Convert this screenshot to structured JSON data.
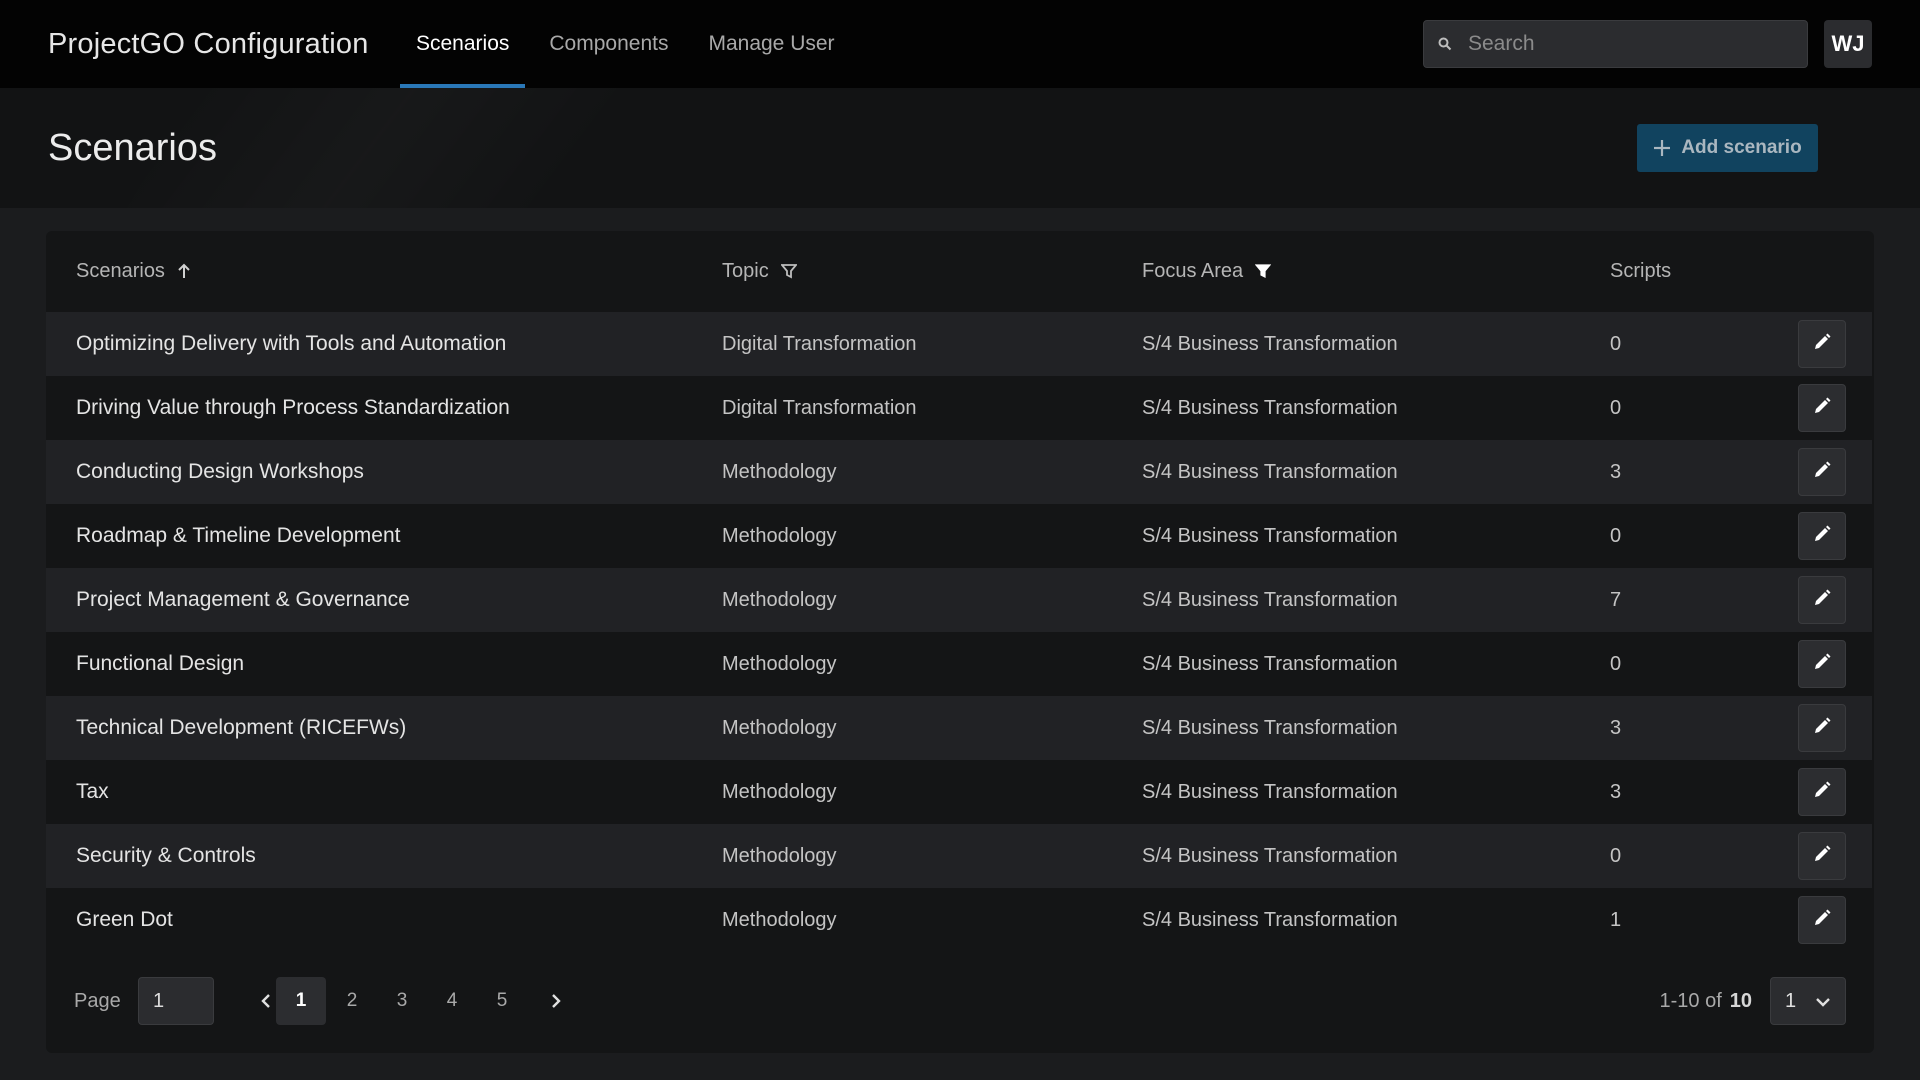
{
  "header": {
    "app_title": "ProjectGO Configuration",
    "tabs": [
      {
        "label": "Scenarios",
        "active": true
      },
      {
        "label": "Components",
        "active": false
      },
      {
        "label": "Manage User",
        "active": false
      }
    ],
    "search_placeholder": "Search",
    "search_icon": "search-icon",
    "avatar_initials": "WJ"
  },
  "subheader": {
    "title": "Scenarios",
    "add_button_label": "Add scenario",
    "add_icon": "plus-icon"
  },
  "table": {
    "columns": {
      "scenarios": "Scenarios",
      "topic": "Topic",
      "focus_area": "Focus Area",
      "scripts": "Scripts"
    },
    "sort_icon": "arrow-up-icon",
    "filter_icon": "filter-icon",
    "edit_icon": "pencil-icon",
    "rows": [
      {
        "name": "Optimizing Delivery with Tools and Automation",
        "topic": "Digital Transformation",
        "focus_area": "S/4 Business Transformation",
        "scripts": "0"
      },
      {
        "name": "Driving Value through Process Standardization",
        "topic": "Digital Transformation",
        "focus_area": "S/4 Business Transformation",
        "scripts": "0"
      },
      {
        "name": "Conducting Design Workshops",
        "topic": "Methodology",
        "focus_area": "S/4 Business Transformation",
        "scripts": "3"
      },
      {
        "name": "Roadmap & Timeline Development",
        "topic": "Methodology",
        "focus_area": "S/4 Business Transformation",
        "scripts": "0"
      },
      {
        "name": "Project Management & Governance",
        "topic": "Methodology",
        "focus_area": "S/4 Business Transformation",
        "scripts": "7"
      },
      {
        "name": "Functional Design",
        "topic": "Methodology",
        "focus_area": "S/4 Business Transformation",
        "scripts": "0"
      },
      {
        "name": "Technical Development (RICEFWs)",
        "topic": "Methodology",
        "focus_area": "S/4 Business Transformation",
        "scripts": "3"
      },
      {
        "name": "Tax",
        "topic": "Methodology",
        "focus_area": "S/4 Business Transformation",
        "scripts": "3"
      },
      {
        "name": "Security & Controls",
        "topic": "Methodology",
        "focus_area": "S/4 Business Transformation",
        "scripts": "0"
      },
      {
        "name": "Green Dot",
        "topic": "Methodology",
        "focus_area": "S/4 Business Transformation",
        "scripts": "1"
      }
    ]
  },
  "pagination": {
    "page_label": "Page",
    "page_input_value": "1",
    "pages": [
      "1",
      "2",
      "3",
      "4",
      "5"
    ],
    "current_page": "1",
    "range_text": "1-10 of",
    "total": "10",
    "per_page_value": "1",
    "prev_icon": "chevron-left-icon",
    "next_icon": "chevron-right-icon",
    "dropdown_icon": "chevron-down-icon"
  },
  "colors": {
    "accent": "#2a78b8",
    "add_button_bg": "#11435f",
    "header_bg": "#030303"
  }
}
